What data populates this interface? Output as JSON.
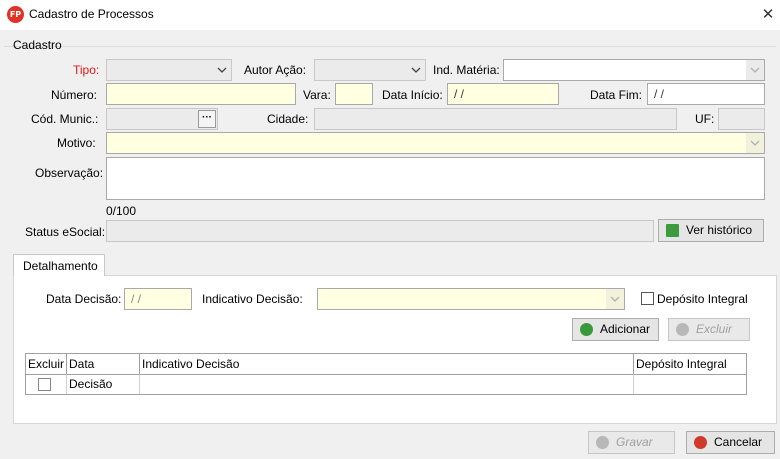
{
  "window": {
    "title": "Cadastro de Processos",
    "icon_text": "FP",
    "close": "✕"
  },
  "group": {
    "title": "Cadastro"
  },
  "fields": {
    "tipo_label": "Tipo:",
    "autor_acao_label": "Autor Ação:",
    "ind_materia_label": "Ind. Matéria:",
    "numero_label": "Número:",
    "vara_label": "Vara:",
    "data_inicio_label": "Data Início:",
    "data_inicio_value": " /  /",
    "data_fim_label": "Data Fim:",
    "data_fim_value": " /  /",
    "cod_munic_label": "Cód. Munic.:",
    "cod_munic_btn": "···",
    "cidade_label": "Cidade:",
    "uf_label": "UF:",
    "motivo_label": "Motivo:",
    "observacao_label": "Observação:",
    "observacao_counter": "0/100",
    "status_esocial_label": "Status eSocial:",
    "ver_historico": "Ver histórico"
  },
  "tabs": [
    {
      "label": "Detalhamento"
    }
  ],
  "detalhamento": {
    "data_decisao_label": "Data Decisão:",
    "data_decisao_value": " /  /",
    "indicativo_decisao_label": "Indicativo Decisão:",
    "deposito_integral_label": "Depósito Integral",
    "adicionar": "Adicionar",
    "excluir": "Excluir",
    "grid": {
      "columns": [
        "Excluir",
        "Data Decisão",
        "Indicativo Decisão",
        "Depósito Integral"
      ]
    }
  },
  "footer": {
    "gravar": "Gravar",
    "cancelar": "Cancelar"
  },
  "colors": {
    "required": "#e01818",
    "input_yellow": "#ffffe1",
    "input_gray": "#ebebeb",
    "ok_green": "#3a9a3a",
    "cancel_red": "#d03a2a"
  }
}
